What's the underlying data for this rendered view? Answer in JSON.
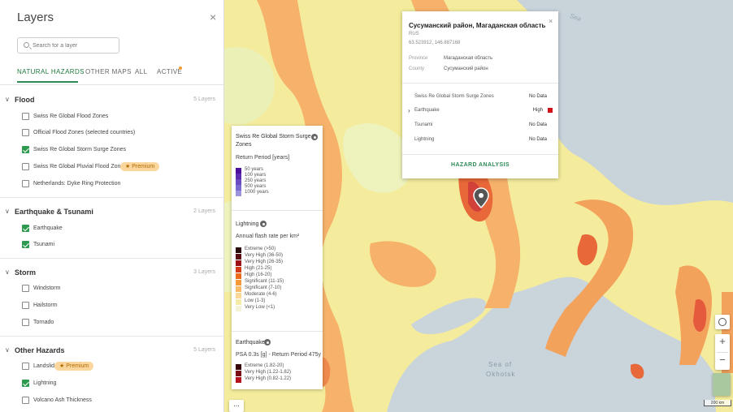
{
  "panel": {
    "title": "Layers",
    "close": "×",
    "search_placeholder": "Search for a layer",
    "tabs": [
      "NATURAL HAZARDS",
      "OTHER MAPS",
      "ALL",
      "ACTIVE"
    ],
    "premium_label": "★ Premium"
  },
  "sections": [
    {
      "name": "Flood",
      "count": "5 Layers",
      "items": [
        {
          "label": "Swiss Re Global Flood Zones",
          "checked": false
        },
        {
          "label": "Official Flood Zones (selected countries)",
          "checked": false
        },
        {
          "label": "Swiss Re Global Storm Surge Zones",
          "checked": true
        },
        {
          "label": "Swiss Re Global Pluvial Flood Zones",
          "checked": false
        },
        {
          "label": "Netherlands: Dyke Ring Protection",
          "checked": false
        }
      ]
    },
    {
      "name": "Earthquake & Tsunami",
      "count": "2 Layers",
      "items": [
        {
          "label": "Earthquake",
          "checked": true
        },
        {
          "label": "Tsunami",
          "checked": true
        }
      ]
    },
    {
      "name": "Storm",
      "count": "3 Layers",
      "items": [
        {
          "label": "Windstorm",
          "checked": false
        },
        {
          "label": "Hailstorm",
          "checked": false
        },
        {
          "label": "Tornado",
          "checked": false
        }
      ]
    },
    {
      "name": "Other Hazards",
      "count": "5 Layers",
      "items": [
        {
          "label": "Landslide",
          "checked": false
        },
        {
          "label": "Lightning",
          "checked": true
        },
        {
          "label": "Volcano Ash Thickness",
          "checked": false
        }
      ]
    }
  ],
  "legend": {
    "surge": {
      "title1": "Swiss Re Global Storm Surge",
      "title2": "Zones",
      "subtitle": "Return Period [years]",
      "rows": [
        {
          "label": "50 years",
          "color": "#4b0f9c"
        },
        {
          "label": "100 years",
          "color": "#5d2bb0"
        },
        {
          "label": "250 years",
          "color": "#6a4bc0"
        },
        {
          "label": "500 years",
          "color": "#7b6ad0"
        },
        {
          "label": "1000 years",
          "color": "#9b94dd"
        }
      ]
    },
    "lightning": {
      "title": "Lightning",
      "subtitle": "Annual flash rate per km²",
      "rows": [
        {
          "label": "Extreme (>50)",
          "color": "#2a0a0a"
        },
        {
          "label": "Very High (36-50)",
          "color": "#5a0d10"
        },
        {
          "label": "Very High (26-35)",
          "color": "#9c1018"
        },
        {
          "label": "High (21-25)",
          "color": "#d23a18"
        },
        {
          "label": "High (16-20)",
          "color": "#ec6a1c"
        },
        {
          "label": "Significant (11-15)",
          "color": "#f59a3a"
        },
        {
          "label": "Significant (7-10)",
          "color": "#f8bb6a"
        },
        {
          "label": "Moderate (4-6)",
          "color": "#fbd79a"
        },
        {
          "label": "Low (1-3)",
          "color": "#f6eaa8"
        },
        {
          "label": "Very Low (<1)",
          "color": "#f3f1d6"
        }
      ]
    },
    "earthquake": {
      "title": "Earthquake",
      "subtitle": "PSA 0.3s [g] - Return Period 475y",
      "rows": [
        {
          "label": "Extreme (1.82-20)",
          "color": "#3a050a"
        },
        {
          "label": "Very High (1.22-1.82)",
          "color": "#7a0a14"
        },
        {
          "label": "Very High (0.82-1.22)",
          "color": "#b3121c"
        }
      ]
    }
  },
  "popup": {
    "title": "Сусуманский район, Магаданская область",
    "country": "RUS",
    "coords": "63.523912, 146.887168",
    "province_key": "Province",
    "province_val": "Магаданская область",
    "county_key": "County",
    "county_val": "Сусуманский район",
    "rows": [
      {
        "label": "Swiss Re Global Storm Surge Zones",
        "value": "No Data"
      },
      {
        "label": "Earthquake",
        "value": "High"
      },
      {
        "label": "Tsunami",
        "value": "No Data"
      },
      {
        "label": "Lightning",
        "value": "No Data"
      }
    ],
    "action": "HAZARD ANALYSIS"
  },
  "map": {
    "sea_label_1": "Sea of",
    "sea_label_2": "Okhotsk",
    "sea_top": "Sea",
    "scale": "200 km",
    "zoom_in": "+",
    "zoom_out": "−",
    "more": "..."
  }
}
